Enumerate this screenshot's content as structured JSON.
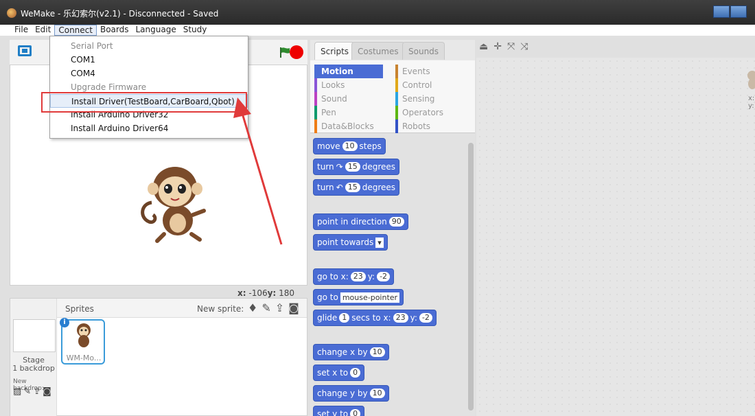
{
  "window": {
    "title": "WeMake - 乐幻索尔(v2.1) - Disconnected - Saved"
  },
  "menubar": {
    "items": [
      "File",
      "Edit",
      "Connect",
      "Boards",
      "Language",
      "Study"
    ]
  },
  "connect_menu": {
    "items": [
      {
        "label": "Serial Port",
        "disabled": true
      },
      {
        "label": "COM1",
        "disabled": false
      },
      {
        "label": "COM4",
        "disabled": false
      },
      {
        "label": "Upgrade Firmware",
        "disabled": true
      },
      {
        "label": "Install Driver(TestBoard,CarBoard,Qbot)",
        "disabled": false
      },
      {
        "label": "Install Arduino Driver32",
        "disabled": false
      },
      {
        "label": "Install Arduino Driver64",
        "disabled": false
      }
    ]
  },
  "stage": {
    "x_label": "x:",
    "x_value": "-106",
    "y_label": "y:",
    "y_value": "180"
  },
  "sprites": {
    "title": "Sprites",
    "new_sprite": "New sprite:",
    "stage_label": "Stage",
    "backdrop_count": "1 backdrop",
    "new_backdrop": "New backdrop:",
    "sprite_name": "WM-Mo..."
  },
  "palette": {
    "tabs": [
      "Scripts",
      "Costumes",
      "Sounds"
    ],
    "categories": [
      {
        "label": "Motion",
        "color": "#4a6cd4",
        "selected": true
      },
      {
        "label": "Events",
        "color": "#c88330"
      },
      {
        "label": "Looks",
        "color": "#8a55d7"
      },
      {
        "label": "Control",
        "color": "#e1a91a"
      },
      {
        "label": "Sound",
        "color": "#bb42c3"
      },
      {
        "label": "Sensing",
        "color": "#2ca5e2"
      },
      {
        "label": "Pen",
        "color": "#0e9a6c"
      },
      {
        "label": "Operators",
        "color": "#5cb712"
      },
      {
        "label": "Data&Blocks",
        "color": "#ee7d16"
      },
      {
        "label": "Robots",
        "color": "#3353c6"
      }
    ],
    "blocks": {
      "move": {
        "pre": "move",
        "val": "10",
        "post": "steps"
      },
      "turn_right": {
        "pre": "turn",
        "val": "15",
        "post": "degrees"
      },
      "turn_left": {
        "pre": "turn",
        "val": "15",
        "post": "degrees"
      },
      "point_dir": {
        "pre": "point in direction",
        "val": "90"
      },
      "point_towards": {
        "pre": "point towards"
      },
      "goto_xy": {
        "pre": "go to x:",
        "x": "23",
        "mid": "y:",
        "y": "-2"
      },
      "goto": {
        "pre": "go to",
        "val": "mouse-pointer"
      },
      "glide": {
        "pre": "glide",
        "secs": "1",
        "mid": "secs to x:",
        "x": "23",
        "y_label": "y:",
        "y": "-2"
      },
      "change_x": {
        "pre": "change x by",
        "val": "10"
      },
      "set_x": {
        "pre": "set x to",
        "val": "0"
      },
      "change_y": {
        "pre": "change y by",
        "val": "10"
      },
      "set_y": {
        "pre": "set y to",
        "val": "0"
      }
    }
  },
  "script_area": {
    "peek_x": "x:",
    "peek_y": "y:"
  },
  "colors": {
    "highlight_box": "#e03a3a",
    "motion": "#4a6cd4"
  }
}
